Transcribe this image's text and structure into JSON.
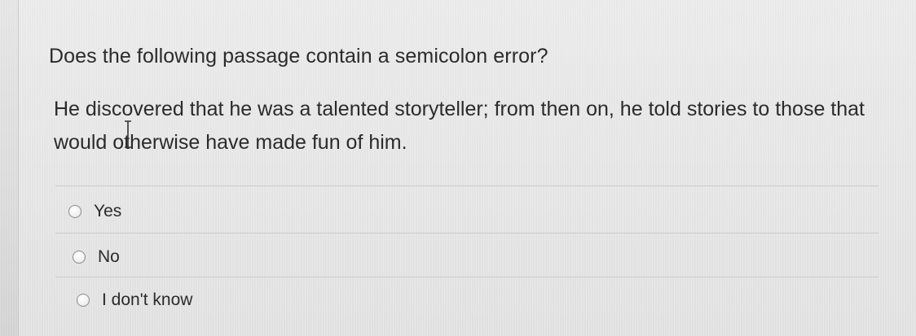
{
  "question": {
    "prompt": "Does the following passage contain a semicolon error?",
    "passage": "He discovered that he was a talented storyteller; from then on, he told stories to those that would otherwise have made fun of him."
  },
  "options": [
    {
      "label": "Yes",
      "selected": false
    },
    {
      "label": "No",
      "selected": false
    },
    {
      "label": "I don't know",
      "selected": false
    }
  ],
  "cursor": {
    "icon": "text-cursor-icon"
  }
}
